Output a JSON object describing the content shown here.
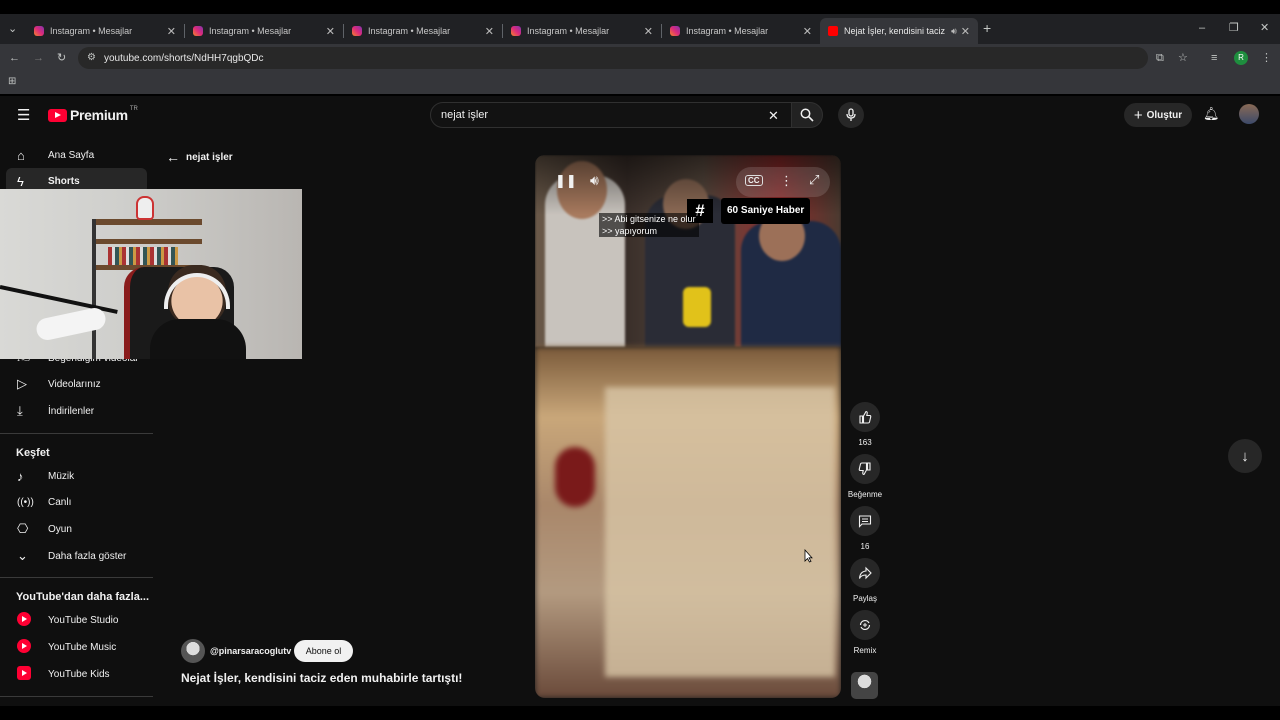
{
  "browser": {
    "tabs": [
      {
        "title": "Instagram • Mesajlar"
      },
      {
        "title": "Instagram • Mesajlar"
      },
      {
        "title": "Instagram • Mesajlar"
      },
      {
        "title": "Instagram • Mesajlar"
      },
      {
        "title": "Instagram • Mesajlar"
      },
      {
        "title": "Nejat İşler, kendisini taciz e"
      }
    ],
    "url": "youtube.com/shorts/NdHH7qgbQDc"
  },
  "youtube": {
    "logo_text": "Premium",
    "logo_badge": "TR",
    "search_value": "nejat işler",
    "create_label": "Oluştur",
    "sidebar": {
      "items_top": [
        {
          "label": "Ana Sayfa",
          "icon": "home-icon"
        },
        {
          "label": "Shorts",
          "icon": "shorts-icon"
        }
      ],
      "items_you": [
        {
          "label": "Beğendiğim videolar",
          "icon": "like-icon"
        },
        {
          "label": "Videolarınız",
          "icon": "video-icon"
        },
        {
          "label": "İndirilenler",
          "icon": "download-icon"
        }
      ],
      "explore_title": "Keşfet",
      "explore_items": [
        {
          "label": "Müzik",
          "icon": "music-icon"
        },
        {
          "label": "Canlı",
          "icon": "live-icon"
        },
        {
          "label": "Oyun",
          "icon": "gaming-icon"
        },
        {
          "label": "Daha fazla göster",
          "icon": "chevron-down-icon"
        }
      ],
      "more_title": "YouTube'dan daha fazla...",
      "more_items": [
        {
          "label": "YouTube Studio"
        },
        {
          "label": "YouTube Music"
        },
        {
          "label": "YouTube Kids"
        }
      ]
    },
    "back_label": "nejat işler",
    "short": {
      "channel_badge": "60 Saniye Haber",
      "subtitle_line1": ">> Abi gitsenize ne olur",
      "subtitle_line2": ">> yapıyorum",
      "channel_handle": "@pinarsaracogl utv",
      "subscribe_label": "Abone ol",
      "title": "Nejat İşler, kendisini taciz eden muhabirle tartıştı!"
    },
    "actions": {
      "likes": "163",
      "dislike_label": "Beğenme",
      "comments": "16",
      "share_label": "Paylaş",
      "remix_label": "Remix"
    }
  }
}
